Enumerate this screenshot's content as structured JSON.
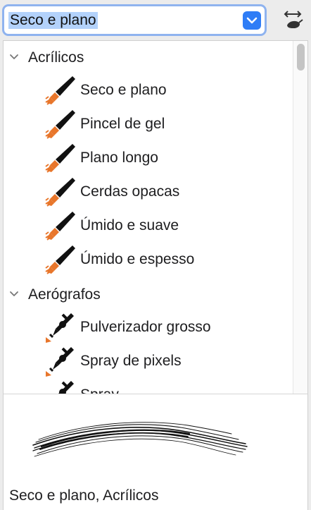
{
  "brush_selector": {
    "selected_value": "Seco e plano",
    "dropdown_icon": "chevron-down-icon",
    "tool_icon": "swap-brush-icon"
  },
  "brush_list": {
    "groups": [
      {
        "label": "Acrílicos",
        "items": [
          {
            "label": "Seco e plano",
            "icon": "brush-icon"
          },
          {
            "label": "Pincel de gel",
            "icon": "brush-icon"
          },
          {
            "label": "Plano longo",
            "icon": "brush-icon"
          },
          {
            "label": "Cerdas opacas",
            "icon": "brush-icon"
          },
          {
            "label": "Úmido e suave",
            "icon": "brush-icon"
          },
          {
            "label": "Úmido e espesso",
            "icon": "brush-icon"
          }
        ]
      },
      {
        "label": "Aerógrafos",
        "items": [
          {
            "label": "Pulverizador grosso",
            "icon": "airbrush-icon"
          },
          {
            "label": "Spray de pixels",
            "icon": "airbrush-icon"
          },
          {
            "label": "Spray",
            "icon": "airbrush-icon"
          }
        ]
      }
    ]
  },
  "preview": {
    "caption": "Seco e plano, Acrílicos"
  },
  "colors": {
    "accent": "#2f7df6",
    "selection": "#b3d2fb",
    "brush_tip": "#e8762b",
    "brush_body": "#111111"
  }
}
